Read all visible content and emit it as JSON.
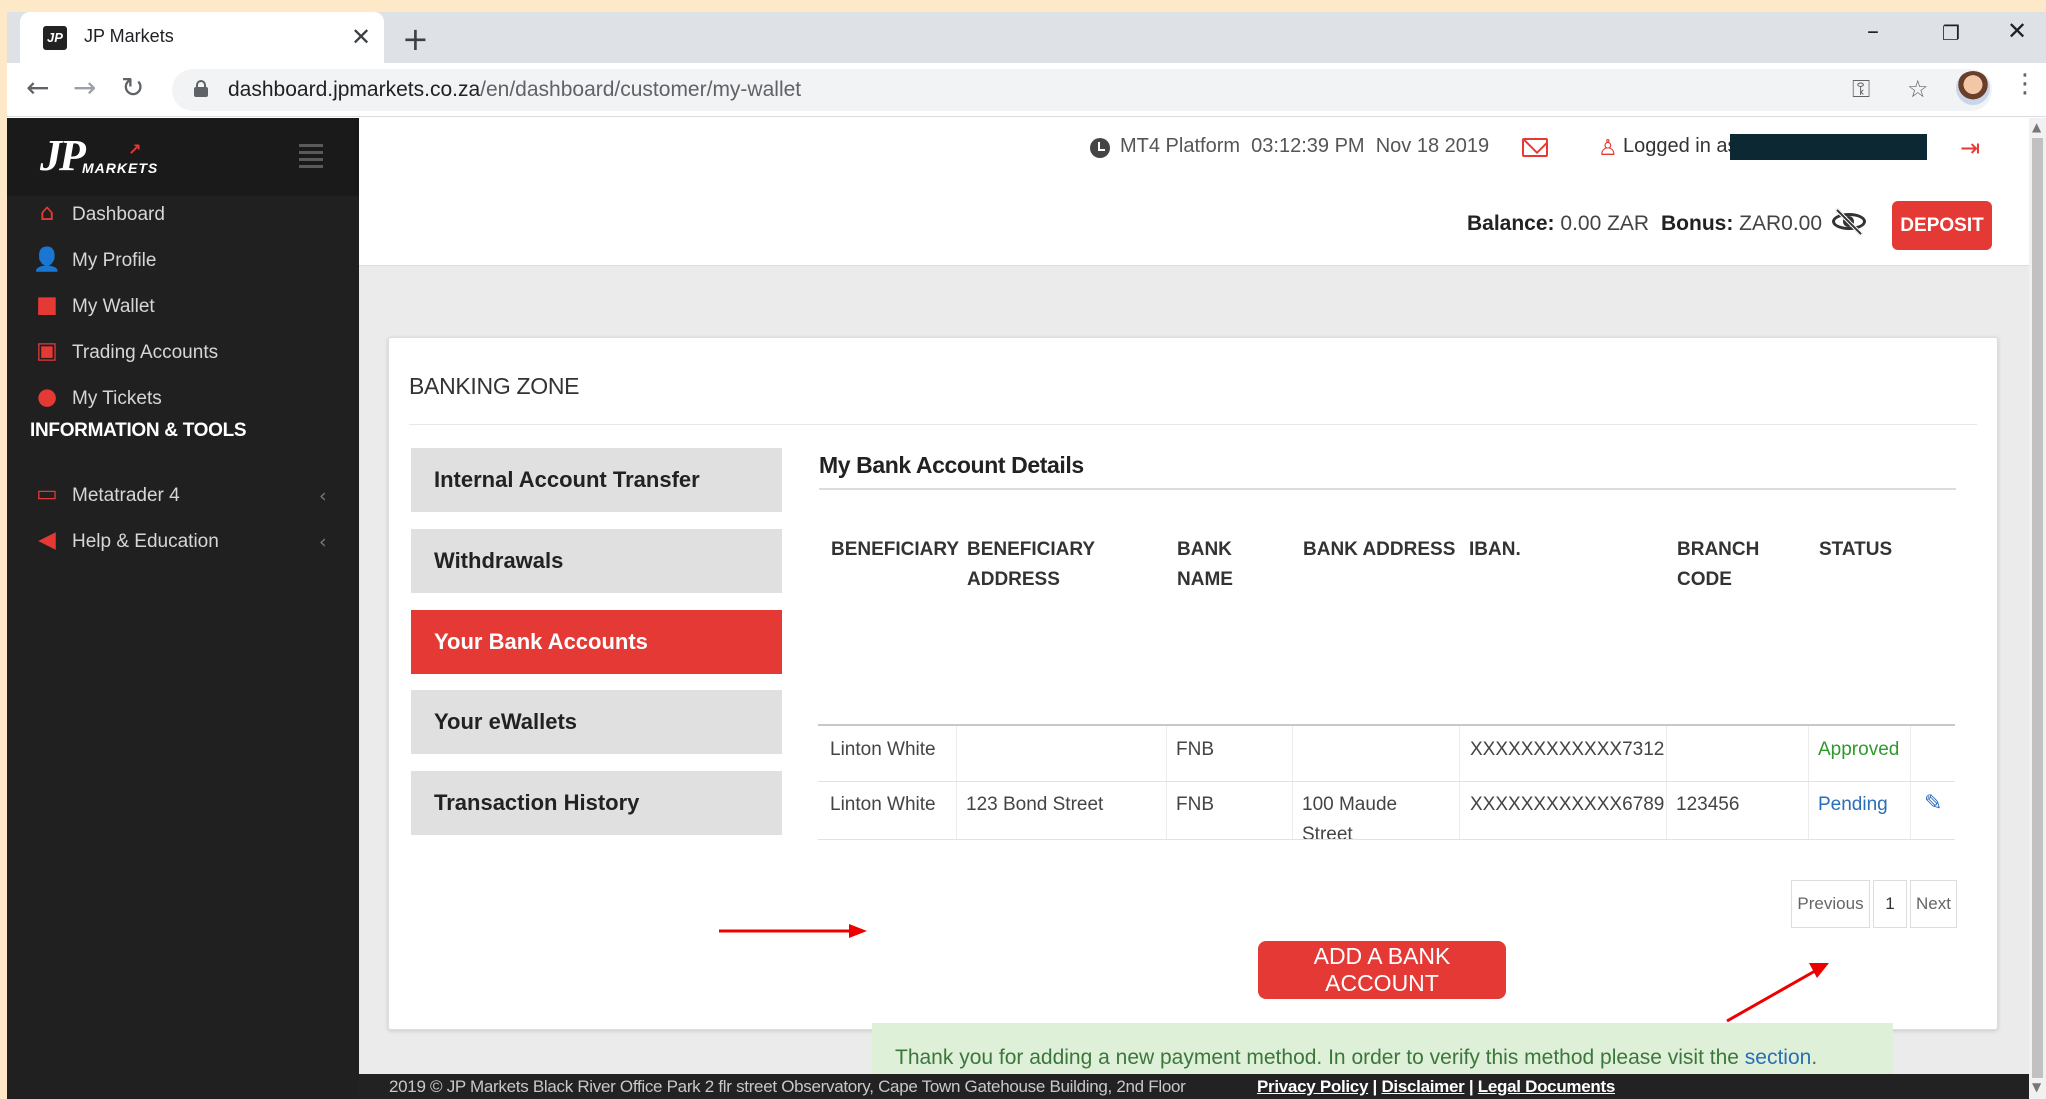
{
  "browser": {
    "tab_title": "JP Markets",
    "favicon_text": "JP",
    "tab_close": "✕",
    "new_tab": "+",
    "url_host": "dashboard.jpmarkets.co.za",
    "url_path": "/en/dashboard/customer/my-wallet",
    "window_controls": {
      "minimize": "–",
      "restore": "❐",
      "close": "✕"
    }
  },
  "sidebar": {
    "logo": "JP",
    "logo_sub": "MARKETS",
    "items": [
      {
        "label": "Dashboard",
        "icon": "home-icon"
      },
      {
        "label": "My Profile",
        "icon": "user-icon"
      },
      {
        "label": "My Wallet",
        "icon": "folder-icon"
      },
      {
        "label": "Trading Accounts",
        "icon": "briefcase-icon"
      },
      {
        "label": "My Tickets",
        "icon": "chat-icon"
      }
    ],
    "section_heading": "INFORMATION & TOOLS",
    "tools": [
      {
        "label": "Metatrader 4",
        "icon": "monitor-icon"
      },
      {
        "label": "Help & Education",
        "icon": "megaphone-icon"
      }
    ]
  },
  "header": {
    "platform": "MT4 Platform",
    "time": "03:12:39 PM",
    "date": "Nov 18 2019",
    "logged_in": "Logged in as",
    "balance_label": "Balance:",
    "balance_value": "0.00 ZAR",
    "bonus_label": "Bonus:",
    "bonus_value": "ZAR0.00",
    "deposit": "DEPOSIT"
  },
  "banking": {
    "title": "BANKING ZONE",
    "menu": [
      "Internal Account Transfer",
      "Withdrawals",
      "Your Bank Accounts",
      "Your eWallets",
      "Transaction History"
    ],
    "active_menu": "Your Bank Accounts",
    "section_title": "My Bank Account Details",
    "columns": [
      [
        "",
        "BENEFICIARY"
      ],
      [
        "BENEFICIARY",
        "ADDRESS"
      ],
      [
        "BANK",
        "NAME"
      ],
      [
        "",
        "BANK ADDRESS"
      ],
      [
        "",
        "IBAN."
      ],
      [
        "BRANCH",
        "CODE"
      ],
      [
        "",
        "STATUS"
      ]
    ],
    "rows": [
      {
        "beneficiary": "Linton White",
        "address": "",
        "bank": "FNB",
        "bank_address": "",
        "iban": "XXXXXXXXXXXX7312",
        "branch": "",
        "status": "Approved"
      },
      {
        "beneficiary": "Linton White",
        "address": "123 Bond Street",
        "bank": "FNB",
        "bank_address_1": "100 Maude",
        "bank_address_2": "Street",
        "iban": "XXXXXXXXXXXX6789",
        "branch": "123456",
        "status": "Pending"
      }
    ],
    "pager": {
      "prev": "Previous",
      "page": "1",
      "next": "Next"
    },
    "add_button": "ADD A BANK ACCOUNT",
    "alert_text": "Thank you for adding a new payment method. In order to verify this method please visit the ",
    "alert_link": "section",
    "alert_end": "."
  },
  "footer": {
    "text": "2019 © JP Markets Black River Office Park 2 flr street Observatory, Cape Town Gatehouse Building, 2nd Floor",
    "privacy": "Privacy Policy",
    "disclaimer": "Disclaimer",
    "legal": "Legal Documents",
    "sep": "|"
  },
  "colors": {
    "accent": "#e53935",
    "sidebar": "#202020",
    "success_bg": "#dff0d8",
    "link": "#2a6db8"
  }
}
